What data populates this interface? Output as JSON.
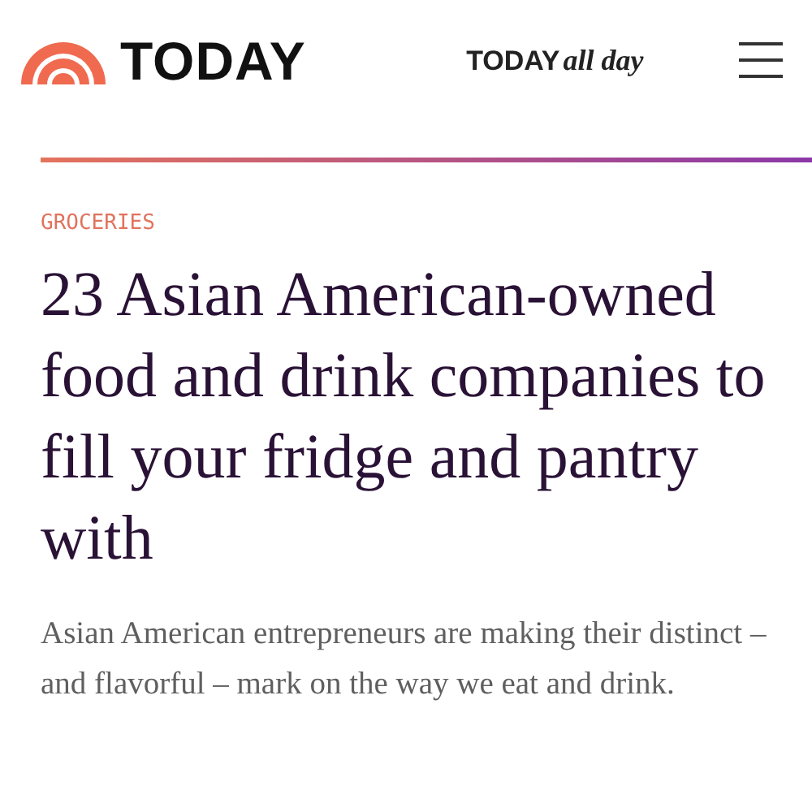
{
  "header": {
    "logo_text": "TODAY",
    "all_day_link": {
      "brand": "TODAY",
      "suffix": "all day"
    }
  },
  "article": {
    "category": "GROCERIES",
    "headline": "23 Asian American-owned food and drink companies to fill your fridge and pantry with",
    "summary": "Asian American entrepreneurs are making their distinct – and flavorful – mark on the way we eat and drink."
  }
}
